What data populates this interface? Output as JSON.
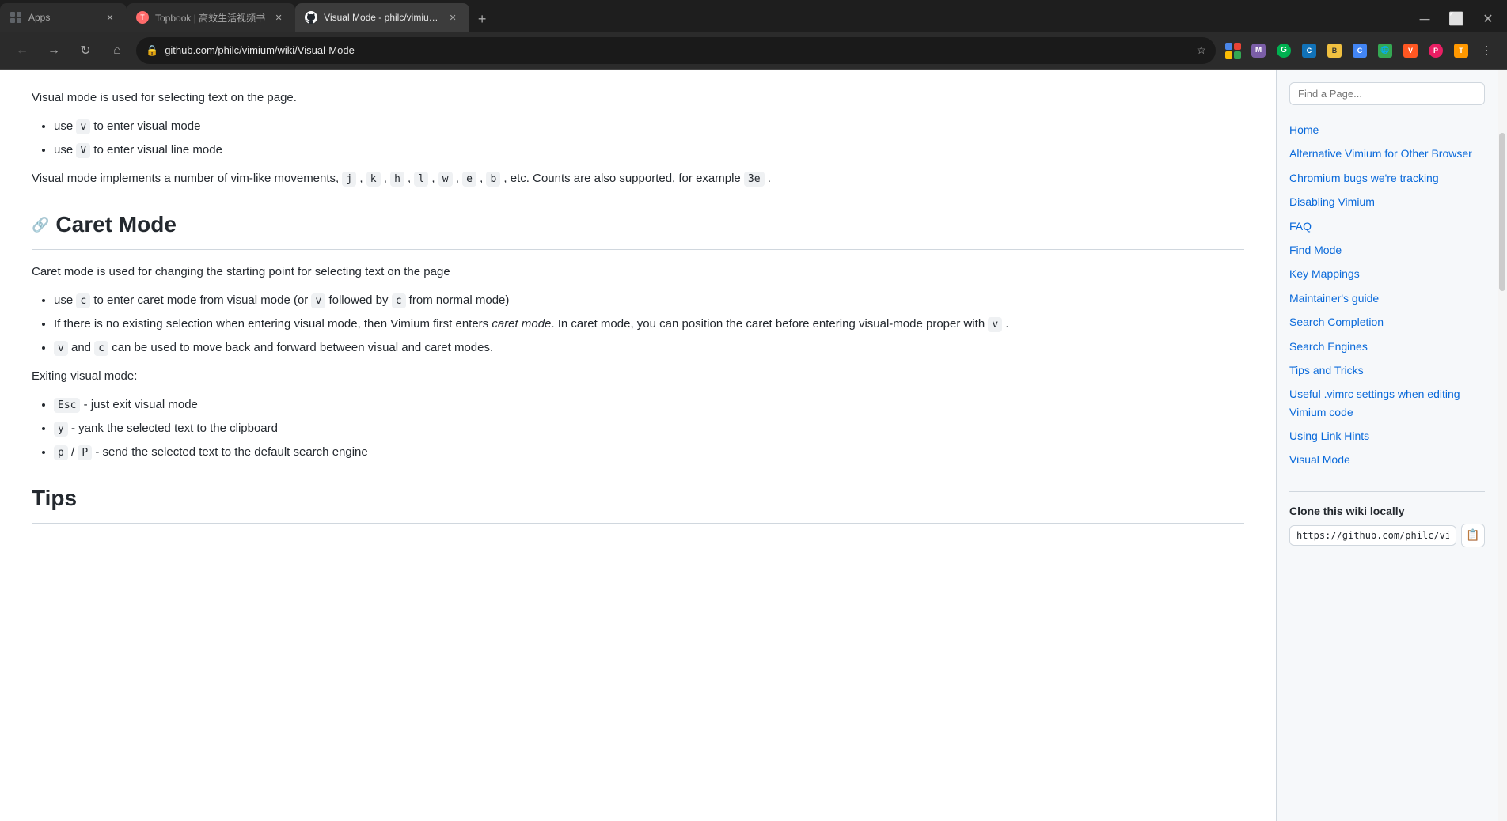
{
  "browser": {
    "tabs": [
      {
        "id": "tab-apps",
        "favicon": "grid",
        "title": "Apps",
        "active": false,
        "closeable": true
      },
      {
        "id": "tab-topbook",
        "favicon": "T",
        "title": "Topbook | 高效生活视频书",
        "active": false,
        "closeable": true
      },
      {
        "id": "tab-vimium",
        "favicon": "gh",
        "title": "Visual Mode - philc/vimium Wi...",
        "active": true,
        "closeable": true
      }
    ],
    "new_tab_label": "+",
    "address": "github.com/philc/vimium/wiki/Visual-Mode",
    "nav": {
      "back_disabled": false,
      "forward_disabled": false
    }
  },
  "page": {
    "intro_text": "Visual mode is used for selecting text on the page.",
    "bullets_visual": [
      "use  v  to enter visual mode",
      "use  V  to enter visual line mode"
    ],
    "para_implements": "Visual mode implements a number of vim-like movements,  j ,  k ,  h ,  l ,  w ,  e ,  b , etc. Counts are also supported, for example  3e .",
    "caret_heading": "Caret Mode",
    "caret_intro": "Caret mode is used for changing the starting point for selecting text on the page",
    "bullets_caret": [
      "use  c  to enter caret mode from visual mode (or  v  followed by  c  from normal mode)",
      "If there is no existing selection when entering visual mode, then Vimium first enters caret mode. In caret mode, you can position the caret before entering visual-mode proper with  v .",
      " v  and  c  can be used to move back and forward between visual and caret modes."
    ],
    "exiting_label": "Exiting visual mode:",
    "bullets_exit": [
      " Esc  - just exit visual mode",
      " y  - yank the selected text to the clipboard",
      " p / P  - send the selected text to the default search engine"
    ],
    "tips_heading": "Tips"
  },
  "sidebar": {
    "search_placeholder": "Find a Page...",
    "nav_links": [
      {
        "label": "Home",
        "href": "#"
      },
      {
        "label": "Alternative Vimium for Other Browser",
        "href": "#"
      },
      {
        "label": "Chromium bugs we're tracking",
        "href": "#"
      },
      {
        "label": "Disabling Vimium",
        "href": "#"
      },
      {
        "label": "FAQ",
        "href": "#"
      },
      {
        "label": "Find Mode",
        "href": "#"
      },
      {
        "label": "Key Mappings",
        "href": "#"
      },
      {
        "label": "Maintainer's guide",
        "href": "#"
      },
      {
        "label": "Search Completion",
        "href": "#"
      },
      {
        "label": "Search Engines",
        "href": "#"
      },
      {
        "label": "Tips and Tricks",
        "href": "#"
      },
      {
        "label": "Useful .vimrc settings when editing Vimium code",
        "href": "#"
      },
      {
        "label": "Using Link Hints",
        "href": "#"
      },
      {
        "label": "Visual Mode",
        "href": "#"
      }
    ],
    "clone_title": "Clone this wiki locally",
    "clone_url": "https://github.com/philc/vi",
    "clone_copy_icon": "📋"
  }
}
